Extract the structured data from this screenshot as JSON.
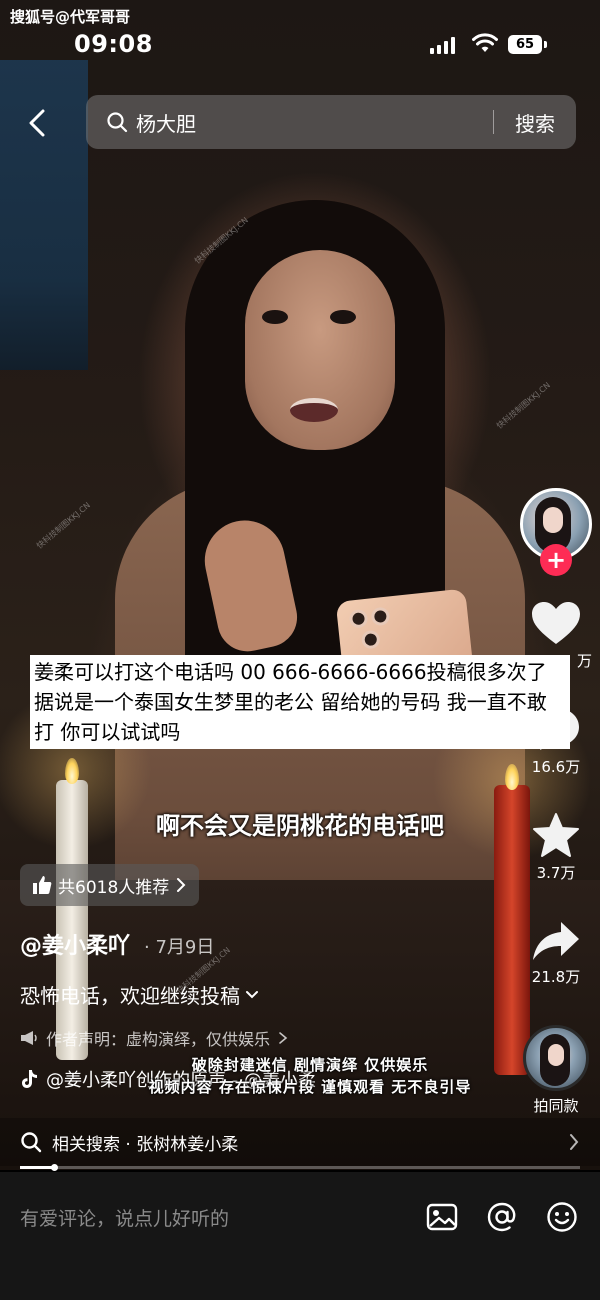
{
  "source_label": "搜狐号@代军哥哥",
  "status": {
    "time": "09:08",
    "battery": "65"
  },
  "search": {
    "query": "杨大胆",
    "button": "搜索"
  },
  "rail": {
    "likes": "万",
    "comments": "16.6万",
    "favorites": "3.7万",
    "shares": "21.8万",
    "same_style": "拍同款"
  },
  "overlay_text": "姜柔可以打这个电话吗 00 666-6666-6666投稿很多次了 据说是一个泰国女生梦里的老公 留给她的号码 我一直不敢打 你可以试试吗",
  "subtitle": "啊不会又是阴桃花的电话吧",
  "recommend": "共6018人推荐",
  "author": "@姜小柔吖",
  "date": "· 7月9日",
  "caption": "恐怖电话，欢迎继续投稿",
  "disclaimer": "作者声明：虚构演绎，仅供娱乐",
  "music": "@姜小柔吖创作的原声 - @姜小柔",
  "overlay_sub_1": "破除封建迷信 剧情演绎 仅供娱乐",
  "overlay_sub_2": "视频内容 存在惊悚片段 谨慎观看 无不良引导",
  "related": {
    "text": "相关搜索 · 张树林姜小柔"
  },
  "progress": 0.06,
  "comment_placeholder": "有爱评论，说点儿好听的",
  "watermark": "快科技制图KKJ.CN",
  "colors": {
    "follow": "#fe2c55",
    "comment_bar": "#161616"
  }
}
